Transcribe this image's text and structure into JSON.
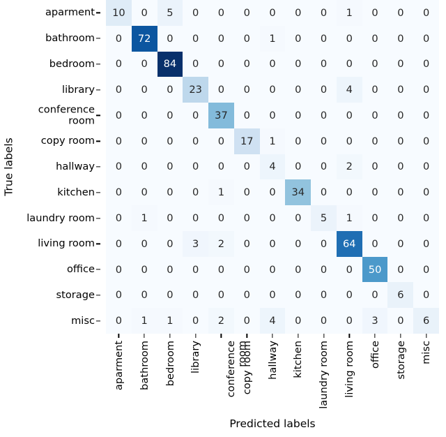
{
  "figure": {
    "xlabel": "Predicted labels",
    "ylabel": "True labels"
  },
  "chart_data": {
    "type": "heatmap",
    "subtype": "confusion-matrix",
    "title": "",
    "xlabel": "Predicted labels",
    "ylabel": "True labels",
    "colormap": "Blues",
    "grid": false,
    "legend": "none",
    "vmin": 0,
    "vmax": 84,
    "categories": [
      "aparment",
      "bathroom",
      "bedroom",
      "library",
      "conference\nroom",
      "copy room",
      "hallway",
      "kitchen",
      "laundry room",
      "living room",
      "office",
      "storage",
      "misc"
    ],
    "x_tick_labels": [
      "aparment",
      "bathroom",
      "bedroom",
      "library",
      "conference\nroom",
      "copy room",
      "hallway",
      "kitchen",
      "laundry room",
      "living room",
      "office",
      "storage",
      "misc"
    ],
    "y_tick_labels": [
      "aparment",
      "bathroom",
      "bedroom",
      "library",
      "conference\nroom",
      "copy room",
      "hallway",
      "kitchen",
      "laundry room",
      "living room",
      "office",
      "storage",
      "misc"
    ],
    "values": [
      [
        10,
        0,
        5,
        0,
        0,
        0,
        0,
        0,
        0,
        1,
        0,
        0,
        0
      ],
      [
        0,
        72,
        0,
        0,
        0,
        0,
        1,
        0,
        0,
        0,
        0,
        0,
        0
      ],
      [
        0,
        0,
        84,
        0,
        0,
        0,
        0,
        0,
        0,
        0,
        0,
        0,
        0
      ],
      [
        0,
        0,
        0,
        23,
        0,
        0,
        0,
        0,
        0,
        4,
        0,
        0,
        0
      ],
      [
        0,
        0,
        0,
        0,
        37,
        0,
        0,
        0,
        0,
        0,
        0,
        0,
        0
      ],
      [
        0,
        0,
        0,
        0,
        0,
        17,
        1,
        0,
        0,
        0,
        0,
        0,
        0
      ],
      [
        0,
        0,
        0,
        0,
        0,
        0,
        4,
        0,
        0,
        2,
        0,
        0,
        0
      ],
      [
        0,
        0,
        0,
        0,
        1,
        0,
        0,
        34,
        0,
        0,
        0,
        0,
        0
      ],
      [
        0,
        1,
        0,
        0,
        0,
        0,
        0,
        0,
        5,
        1,
        0,
        0,
        0
      ],
      [
        0,
        0,
        0,
        3,
        2,
        0,
        0,
        0,
        0,
        64,
        0,
        0,
        0
      ],
      [
        0,
        0,
        0,
        0,
        0,
        0,
        0,
        0,
        0,
        0,
        50,
        0,
        0
      ],
      [
        0,
        0,
        0,
        0,
        0,
        0,
        0,
        0,
        0,
        0,
        0,
        6,
        0
      ],
      [
        0,
        1,
        1,
        0,
        2,
        0,
        4,
        0,
        0,
        0,
        3,
        0,
        6
      ]
    ]
  }
}
